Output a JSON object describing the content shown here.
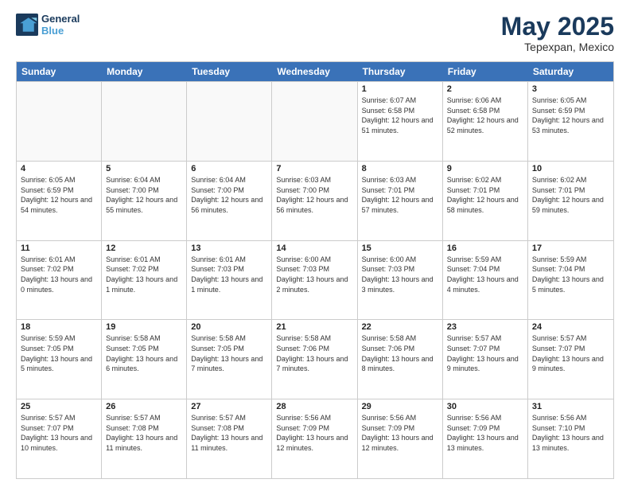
{
  "logo": {
    "line1": "General",
    "line2": "Blue"
  },
  "header": {
    "title": "May 2025",
    "location": "Tepexpan, Mexico"
  },
  "days_of_week": [
    "Sunday",
    "Monday",
    "Tuesday",
    "Wednesday",
    "Thursday",
    "Friday",
    "Saturday"
  ],
  "weeks": [
    [
      {
        "day": "",
        "empty": true
      },
      {
        "day": "",
        "empty": true
      },
      {
        "day": "",
        "empty": true
      },
      {
        "day": "",
        "empty": true
      },
      {
        "day": "1",
        "sunrise": "6:07 AM",
        "sunset": "6:58 PM",
        "daylight": "12 hours and 51 minutes."
      },
      {
        "day": "2",
        "sunrise": "6:06 AM",
        "sunset": "6:58 PM",
        "daylight": "12 hours and 52 minutes."
      },
      {
        "day": "3",
        "sunrise": "6:05 AM",
        "sunset": "6:59 PM",
        "daylight": "12 hours and 53 minutes."
      }
    ],
    [
      {
        "day": "4",
        "sunrise": "6:05 AM",
        "sunset": "6:59 PM",
        "daylight": "12 hours and 54 minutes."
      },
      {
        "day": "5",
        "sunrise": "6:04 AM",
        "sunset": "7:00 PM",
        "daylight": "12 hours and 55 minutes."
      },
      {
        "day": "6",
        "sunrise": "6:04 AM",
        "sunset": "7:00 PM",
        "daylight": "12 hours and 56 minutes."
      },
      {
        "day": "7",
        "sunrise": "6:03 AM",
        "sunset": "7:00 PM",
        "daylight": "12 hours and 56 minutes."
      },
      {
        "day": "8",
        "sunrise": "6:03 AM",
        "sunset": "7:01 PM",
        "daylight": "12 hours and 57 minutes."
      },
      {
        "day": "9",
        "sunrise": "6:02 AM",
        "sunset": "7:01 PM",
        "daylight": "12 hours and 58 minutes."
      },
      {
        "day": "10",
        "sunrise": "6:02 AM",
        "sunset": "7:01 PM",
        "daylight": "12 hours and 59 minutes."
      }
    ],
    [
      {
        "day": "11",
        "sunrise": "6:01 AM",
        "sunset": "7:02 PM",
        "daylight": "13 hours and 0 minutes."
      },
      {
        "day": "12",
        "sunrise": "6:01 AM",
        "sunset": "7:02 PM",
        "daylight": "13 hours and 1 minute."
      },
      {
        "day": "13",
        "sunrise": "6:01 AM",
        "sunset": "7:03 PM",
        "daylight": "13 hours and 1 minute."
      },
      {
        "day": "14",
        "sunrise": "6:00 AM",
        "sunset": "7:03 PM",
        "daylight": "13 hours and 2 minutes."
      },
      {
        "day": "15",
        "sunrise": "6:00 AM",
        "sunset": "7:03 PM",
        "daylight": "13 hours and 3 minutes."
      },
      {
        "day": "16",
        "sunrise": "5:59 AM",
        "sunset": "7:04 PM",
        "daylight": "13 hours and 4 minutes."
      },
      {
        "day": "17",
        "sunrise": "5:59 AM",
        "sunset": "7:04 PM",
        "daylight": "13 hours and 5 minutes."
      }
    ],
    [
      {
        "day": "18",
        "sunrise": "5:59 AM",
        "sunset": "7:05 PM",
        "daylight": "13 hours and 5 minutes."
      },
      {
        "day": "19",
        "sunrise": "5:58 AM",
        "sunset": "7:05 PM",
        "daylight": "13 hours and 6 minutes."
      },
      {
        "day": "20",
        "sunrise": "5:58 AM",
        "sunset": "7:05 PM",
        "daylight": "13 hours and 7 minutes."
      },
      {
        "day": "21",
        "sunrise": "5:58 AM",
        "sunset": "7:06 PM",
        "daylight": "13 hours and 7 minutes."
      },
      {
        "day": "22",
        "sunrise": "5:58 AM",
        "sunset": "7:06 PM",
        "daylight": "13 hours and 8 minutes."
      },
      {
        "day": "23",
        "sunrise": "5:57 AM",
        "sunset": "7:07 PM",
        "daylight": "13 hours and 9 minutes."
      },
      {
        "day": "24",
        "sunrise": "5:57 AM",
        "sunset": "7:07 PM",
        "daylight": "13 hours and 9 minutes."
      }
    ],
    [
      {
        "day": "25",
        "sunrise": "5:57 AM",
        "sunset": "7:07 PM",
        "daylight": "13 hours and 10 minutes."
      },
      {
        "day": "26",
        "sunrise": "5:57 AM",
        "sunset": "7:08 PM",
        "daylight": "13 hours and 11 minutes."
      },
      {
        "day": "27",
        "sunrise": "5:57 AM",
        "sunset": "7:08 PM",
        "daylight": "13 hours and 11 minutes."
      },
      {
        "day": "28",
        "sunrise": "5:56 AM",
        "sunset": "7:09 PM",
        "daylight": "13 hours and 12 minutes."
      },
      {
        "day": "29",
        "sunrise": "5:56 AM",
        "sunset": "7:09 PM",
        "daylight": "13 hours and 12 minutes."
      },
      {
        "day": "30",
        "sunrise": "5:56 AM",
        "sunset": "7:09 PM",
        "daylight": "13 hours and 13 minutes."
      },
      {
        "day": "31",
        "sunrise": "5:56 AM",
        "sunset": "7:10 PM",
        "daylight": "13 hours and 13 minutes."
      }
    ]
  ]
}
